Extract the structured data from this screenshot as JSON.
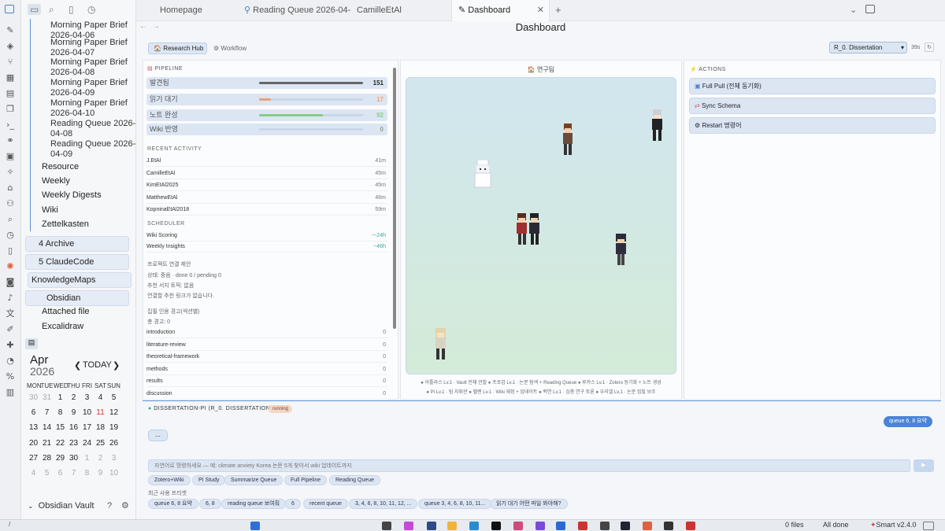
{
  "sidebar": {
    "files": [
      "Morning Paper Brief 2026-04-06",
      "Morning Paper Brief 2026-04-07",
      "Morning Paper Brief 2026-04-08",
      "Morning Paper Brief 2026-04-09",
      "Morning Paper Brief 2026-04-10",
      "Reading Queue 2026-04-08",
      "Reading Queue 2026-04-09"
    ],
    "folders": [
      "Resource",
      "Weekly",
      "Weekly Digests",
      "Wiki",
      "Zettelkasten"
    ],
    "boxed": [
      "4 Archive",
      "5 ClaudeCode",
      "KnowledgeMaps",
      "Obsidian"
    ],
    "sub": [
      "Attached file",
      "Excalidraw"
    ],
    "vault": "Obsidian Vault"
  },
  "calendar": {
    "month": "Apr",
    "year": "2026",
    "today": "TODAY",
    "days": [
      "MON",
      "TUE",
      "WED",
      "THU",
      "FRI",
      "SAT",
      "SUN"
    ],
    "weeks": [
      [
        "30",
        "31",
        "1",
        "2",
        "3",
        "4",
        "5"
      ],
      [
        "6",
        "7",
        "8",
        "9",
        "10",
        "11",
        "12"
      ],
      [
        "13",
        "14",
        "15",
        "16",
        "17",
        "18",
        "19"
      ],
      [
        "20",
        "21",
        "22",
        "23",
        "24",
        "25",
        "26"
      ],
      [
        "27",
        "28",
        "29",
        "30",
        "1",
        "2",
        "3"
      ],
      [
        "4",
        "5",
        "6",
        "7",
        "8",
        "9",
        "10"
      ]
    ]
  },
  "tabs": [
    "Homepage",
    "Reading Queue 2026-04-...",
    "CamilleEtAl",
    "Dashboard"
  ],
  "page": {
    "title": "Dashboard",
    "nav": [
      "Research Hub",
      "Workflow"
    ],
    "select": "R_0. Dissertation",
    "timer": "39s"
  },
  "pipeline": {
    "title": "PIPELINE",
    "stats": [
      {
        "label": "발견됨",
        "value": "151",
        "fill": 1.0,
        "color": "#666666"
      },
      {
        "label": "읽기 대기",
        "value": "17",
        "fill": 0.11,
        "color": "#f0a070"
      },
      {
        "label": "노트 완성",
        "value": "92",
        "fill": 0.61,
        "color": "#88cc88"
      },
      {
        "label": "Wiki 반영",
        "value": "0",
        "fill": 0.0,
        "color": "#999999"
      }
    ],
    "recent_title": "RECENT ACTIVITY",
    "recent": [
      [
        "J.EtAl",
        "41m"
      ],
      [
        "CamilleEtAl",
        "45m"
      ],
      [
        "KimEtAl2025",
        "45m"
      ],
      [
        "MatthewEtAl",
        "46m"
      ],
      [
        "KopninaEtAl2018",
        "59m"
      ]
    ],
    "sched_title": "SCHEDULER",
    "sched": [
      [
        "Wiki Scoring",
        "~-24h"
      ],
      [
        "Weekly Insights",
        "~46h"
      ]
    ],
    "notes": [
      "프로젝트 연결 제안",
      "상태: 중음 · done 0 / pending 0",
      "추천 서지 토픽: 없음",
      "연결할 추천 링크가 없습니다."
    ],
    "cite": [
      "집필 인용 경고(섹션별)",
      "총 경고: 0"
    ],
    "sections": [
      [
        "introduction",
        "0"
      ],
      [
        "literature-review",
        "0"
      ],
      [
        "theoretical-framework",
        "0"
      ],
      [
        "methods",
        "0"
      ],
      [
        "results",
        "0"
      ],
      [
        "discussion",
        "0"
      ]
    ]
  },
  "room": {
    "title": "연구팀",
    "legend1": "● 아틀라스 Lv.1 · Vault 전체 관찰  ● 프로검 Lv.1 · 논문 탐색 + Reading Queue  ● 루카스 Lv.1 · Zotero 동기화 + 노트 생성",
    "legend2": "● Pi Lv.1 · 팀 지휘관  ● 헬렌 Lv.1 · Wiki 재정 + 업데이트  ● 백연 Lv.1 · 심층 연구 토론  ● 우리엘 Lv.1 · 논문 집필 보조"
  },
  "actions": {
    "title": "ACTIONS",
    "items": [
      "Full Pull (전체 동기화)",
      "Sync Schema",
      "Restart 명령어"
    ]
  },
  "chat": {
    "header": "DISSERTATION-PI (R_0. DISSERTATION)",
    "status": "running",
    "bubble": "queue 6, 8 요약",
    "dots": "...",
    "placeholder": "자연어로 명령하세요 — 예: climate anxiety Korea 논문 5개 찾아서 wiki 업데이트까지",
    "quick": [
      "Zotero+Wiki",
      "PI Study",
      "Summarize Queue",
      "Full Pipeline",
      "Reading Queue"
    ],
    "recent_label": "최근 사용 프리셋",
    "recent": [
      "queue 6, 8 요약",
      "6, 8",
      "reading queue 보여줘",
      "6",
      "recent queue",
      "3, 4, 6, 8, 10, 11, 12, ...",
      "queue 3, 4, 6, 8, 10, 11...",
      "읽기 대기 어떤 파일 봐야해?"
    ]
  },
  "status": {
    "files": "0 files",
    "done": "All done",
    "smart": "Smart v2.4.0"
  }
}
